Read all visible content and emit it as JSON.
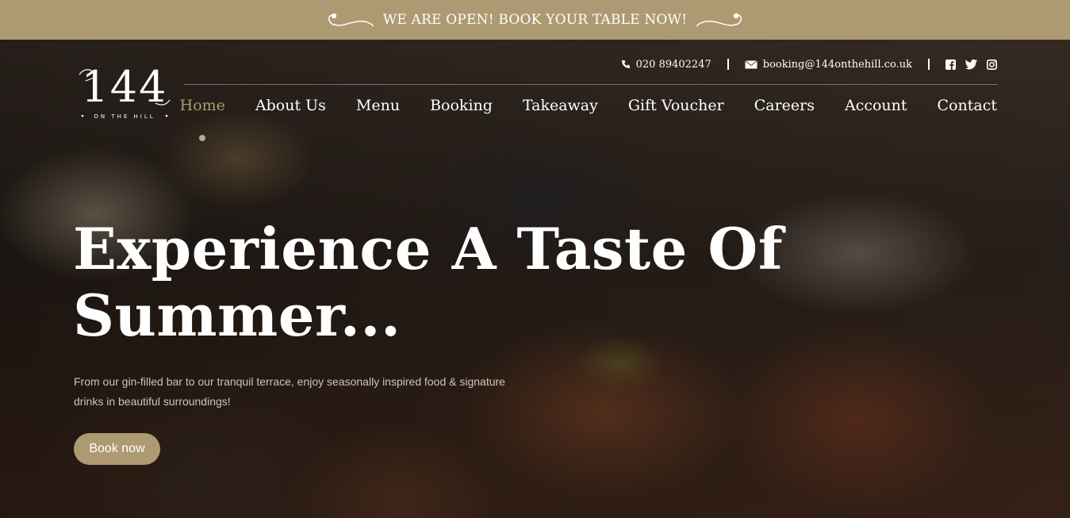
{
  "topbar": {
    "announcement": "WE ARE OPEN! BOOK YOUR TABLE NOW!"
  },
  "logo": {
    "text": "144",
    "subtitle": "ON THE HILL"
  },
  "contact": {
    "phone": "020 89402247",
    "email": "booking@144onthehill.co.uk",
    "social": [
      "facebook-icon",
      "twitter-icon",
      "instagram-icon"
    ]
  },
  "nav": {
    "items": [
      {
        "label": "Home",
        "active": true
      },
      {
        "label": "About Us"
      },
      {
        "label": "Menu"
      },
      {
        "label": "Booking"
      },
      {
        "label": "Takeaway"
      },
      {
        "label": "Gift Voucher"
      },
      {
        "label": "Careers"
      },
      {
        "label": "Account"
      },
      {
        "label": "Contact"
      }
    ]
  },
  "hero": {
    "headline_line1": "Experience A Taste Of",
    "headline_line2": "Summer...",
    "subtext_line1": "From our gin-filled bar to our tranquil terrace, enjoy seasonally inspired food & signature",
    "subtext_line2": "drinks in beautiful surroundings!",
    "cta_label": "Book now"
  },
  "colors": {
    "accent": "#ae9a72",
    "text": "#ffffff"
  }
}
